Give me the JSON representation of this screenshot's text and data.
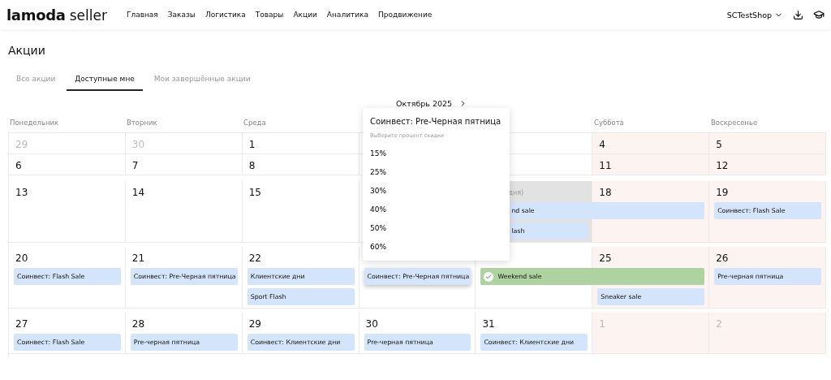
{
  "header": {
    "logo_bold": "lamoda",
    "logo_light": "seller",
    "nav": [
      {
        "label": "Главная"
      },
      {
        "label": "Заказы"
      },
      {
        "label": "Логистика"
      },
      {
        "label": "Товары"
      },
      {
        "label": "Акции"
      },
      {
        "label": "Аналитика"
      },
      {
        "label": "Продвижение"
      }
    ],
    "account": "SCTestShop"
  },
  "page_title": "Акции",
  "tabs": [
    {
      "label": "Все акции",
      "selected": false
    },
    {
      "label": "Доступные мне",
      "selected": true
    },
    {
      "label": "Мои завершённые акции",
      "selected": false
    }
  ],
  "month": "Октябрь 2025",
  "weekdays": {
    "left": [
      "Понедельник",
      "Вторник",
      "Среда"
    ],
    "right": [
      "Суббота",
      "Воскресенье"
    ]
  },
  "weeks": [
    {
      "days": [
        {
          "kind": "day",
          "number": "29",
          "muted": true
        },
        {
          "kind": "day",
          "number": "30",
          "muted": true
        },
        {
          "kind": "day",
          "number": "1"
        },
        {
          "kind": "covered"
        },
        {
          "kind": "covered"
        },
        {
          "kind": "day",
          "number": "4",
          "weekend": true
        },
        {
          "kind": "day",
          "number": "5",
          "weekend": true
        }
      ]
    },
    {
      "days": [
        {
          "kind": "day",
          "number": "6"
        },
        {
          "kind": "day",
          "number": "7"
        },
        {
          "kind": "day",
          "number": "8"
        },
        {
          "kind": "covered"
        },
        {
          "kind": "covered"
        },
        {
          "kind": "day",
          "number": "11",
          "weekend": true
        },
        {
          "kind": "day",
          "number": "12",
          "weekend": true
        }
      ]
    },
    {
      "days": [
        {
          "kind": "day",
          "number": "13"
        },
        {
          "kind": "day",
          "number": "14"
        },
        {
          "kind": "day",
          "number": "15"
        },
        {
          "kind": "covered"
        },
        {
          "kind": "partial",
          "note": "дня)",
          "highlighted": true,
          "events": [
            {
              "label": "nd sale",
              "continues": true
            },
            {
              "label": "lash"
            }
          ]
        },
        {
          "kind": "day",
          "number": "18",
          "weekend": true
        },
        {
          "kind": "day",
          "number": "19",
          "weekend": true,
          "events": [
            {
              "label": "Соинвест: Flash Sale"
            }
          ]
        }
      ]
    },
    {
      "days": [
        {
          "kind": "day",
          "number": "20",
          "events": [
            {
              "label": "Соинвест: Flash Sale"
            }
          ]
        },
        {
          "kind": "day",
          "number": "21",
          "events": [
            {
              "label": "Соинвест: Pre-Черная пятница"
            }
          ]
        },
        {
          "kind": "day",
          "number": "22",
          "events": [
            {
              "label": "Клиентские дни"
            },
            {
              "label": "Sport Flash"
            }
          ]
        },
        {
          "kind": "day",
          "events": [
            {
              "label": "Соинвест: Pre-Черная пятница",
              "hovered": true
            }
          ]
        },
        {
          "kind": "day",
          "events": [
            {
              "label": "Weekend sale",
              "continues": true,
              "done": true
            }
          ]
        },
        {
          "kind": "day",
          "number": "25",
          "weekend": true,
          "events": [
            {
              "label": "Sneaker sale"
            }
          ]
        },
        {
          "kind": "day",
          "number": "26",
          "weekend": true,
          "events": [
            {
              "label": "Pre-черная пятница"
            }
          ]
        }
      ]
    },
    {
      "days": [
        {
          "kind": "day",
          "number": "27",
          "events": [
            {
              "label": "Соинвест: Flash Sale"
            }
          ]
        },
        {
          "kind": "day",
          "number": "28",
          "events": [
            {
              "label": "Pre-черная пятница"
            }
          ]
        },
        {
          "kind": "day",
          "number": "29",
          "events": [
            {
              "label": "Соинвест: Клиентские дни"
            }
          ]
        },
        {
          "kind": "day",
          "number": "30",
          "events": [
            {
              "label": "Pre-черная пятница"
            }
          ]
        },
        {
          "kind": "day",
          "number": "31",
          "events": [
            {
              "label": "Соинвест: Клиентские дни"
            }
          ]
        },
        {
          "kind": "day",
          "number": "1",
          "muted": true,
          "weekend": true
        },
        {
          "kind": "day",
          "number": "2",
          "muted": true,
          "weekend": true
        }
      ]
    }
  ],
  "popover": {
    "title": "Соинвест: Pre-Черная пятница",
    "hint": "Выберите процент скидки",
    "options": [
      "15%",
      "25%",
      "30%",
      "40%",
      "50%",
      "60%"
    ]
  }
}
